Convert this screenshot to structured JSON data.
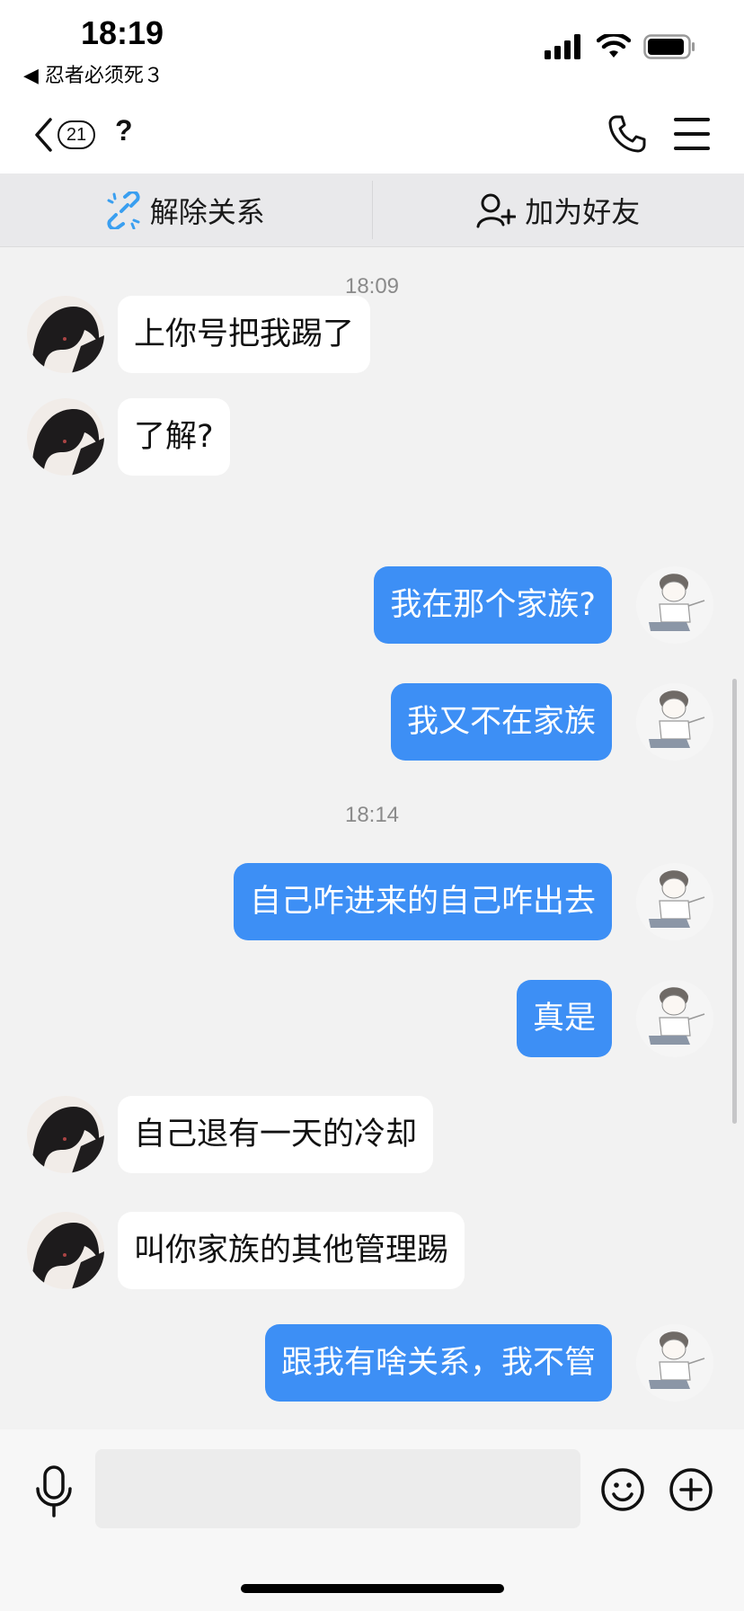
{
  "status_bar": {
    "time": "18:19",
    "back_app": "◀ 忍者必须死３"
  },
  "nav": {
    "unread_count": "21",
    "title": "?"
  },
  "actions": {
    "unlink_label": "解除关系",
    "add_friend_label": "加为好友"
  },
  "chat": {
    "timestamps": [
      "18:09",
      "18:14"
    ],
    "messages": [
      {
        "from": "other",
        "text": "上你号把我踢了"
      },
      {
        "from": "other",
        "text": "了解?"
      },
      {
        "from": "me",
        "text": "我在那个家族?"
      },
      {
        "from": "me",
        "text": "我又不在家族"
      },
      {
        "from": "me",
        "text": "自己咋进来的自己咋出去"
      },
      {
        "from": "me",
        "text": "真是"
      },
      {
        "from": "other",
        "text": "自己退有一天的冷却"
      },
      {
        "from": "other",
        "text": "叫你家族的其他管理踢"
      },
      {
        "from": "me",
        "text": "跟我有啥关系，我不管"
      }
    ]
  },
  "input": {
    "placeholder": "",
    "value": ""
  },
  "colors": {
    "outgoing_bubble": "#3d8ff5",
    "incoming_bubble": "#ffffff",
    "chat_background": "#f2f2f2"
  },
  "icons": [
    "signal-icon",
    "wifi-icon",
    "battery-icon",
    "chevron-left-icon",
    "phone-icon",
    "menu-icon",
    "unlink-icon",
    "add-user-icon",
    "microphone-icon",
    "emoji-icon",
    "plus-icon"
  ]
}
